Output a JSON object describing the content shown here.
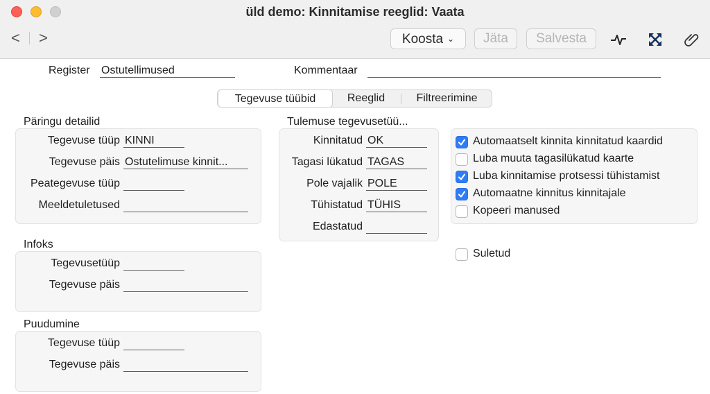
{
  "window": {
    "title": "üld demo: Kinnitamise reeglid: Vaata"
  },
  "toolbar": {
    "back": "<",
    "forward": ">",
    "koosta": "Koosta",
    "jata": "Jäta",
    "salvesta": "Salvesta",
    "icons": [
      "activity-icon",
      "expand-icon",
      "paperclip-icon"
    ]
  },
  "header": {
    "register_label": "Register",
    "register_value": "Ostutellimused",
    "kommentaar_label": "Kommentaar",
    "kommentaar_value": ""
  },
  "tabs": [
    "Tegevuse tüübid",
    "Reeglid",
    "Filtreerimine"
  ],
  "paringu": {
    "title": "Päringu detailid",
    "rows": [
      {
        "label": "Tegevuse tüüp",
        "value": "KINNI"
      },
      {
        "label": "Tegevuse päis",
        "value": "Ostutelimuse kinnit..."
      },
      {
        "label": "Peategevuse tüüp",
        "value": ""
      },
      {
        "label": "Meeldetuletused",
        "value": ""
      }
    ]
  },
  "tulemuse": {
    "title": "Tulemuse tegevusetüü...",
    "rows": [
      {
        "label": "Kinnitatud",
        "value": "OK"
      },
      {
        "label": "Tagasi lükatud",
        "value": "TAGAS"
      },
      {
        "label": "Pole vajalik",
        "value": "POLE"
      },
      {
        "label": "Tühistatud",
        "value": "TÜHIS"
      },
      {
        "label": "Edastatud",
        "value": ""
      }
    ]
  },
  "options": [
    {
      "label": "Automaatselt kinnita kinnitatud kaardid",
      "checked": true
    },
    {
      "label": "Luba muuta tagasilükatud kaarte",
      "checked": false
    },
    {
      "label": "Luba kinnitamise protsessi tühistamist",
      "checked": true
    },
    {
      "label": "Automaatne kinnitus kinnitajale",
      "checked": true
    },
    {
      "label": "Kopeeri manused",
      "checked": false
    }
  ],
  "suletud": {
    "label": "Suletud",
    "checked": false
  },
  "infoks": {
    "title": "Infoks",
    "rows": [
      {
        "label": "Tegevusetüüp",
        "value": ""
      },
      {
        "label": "Tegevuse päis",
        "value": ""
      }
    ]
  },
  "puudumine": {
    "title": "Puudumine",
    "rows": [
      {
        "label": "Tegevuse tüüp",
        "value": ""
      },
      {
        "label": "Tegevuse päis",
        "value": ""
      }
    ]
  },
  "colors": {
    "accent": "#2f7cf6",
    "close": "#ff5f57",
    "minimize": "#febc2e"
  }
}
